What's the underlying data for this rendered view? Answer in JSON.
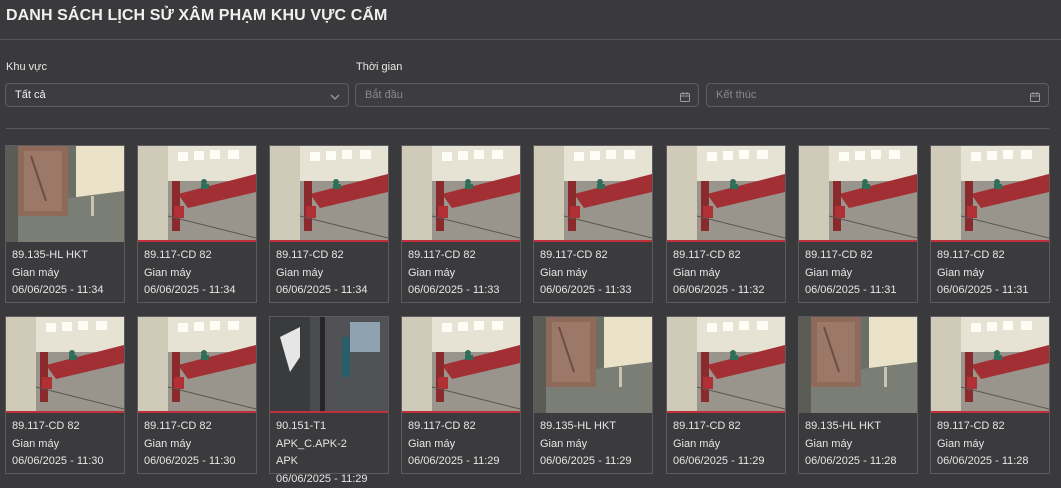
{
  "page": {
    "title": "DANH SÁCH LỊCH SỬ XÂM PHẠM KHU VỰC CẤM"
  },
  "filters": {
    "area_label": "Khu vực",
    "area_value": "Tất cả",
    "time_label": "Thời gian",
    "start_placeholder": "Bắt đầu",
    "end_placeholder": "Kết thúc"
  },
  "icons": {
    "dropdown": "chevron-down-icon",
    "calendar": "calendar-icon"
  },
  "events": [
    {
      "thumb": "pillar",
      "camera": "89.135-HL HKT",
      "area": "Gian máy",
      "time": "06/06/2025 - 11:34"
    },
    {
      "thumb": "hall",
      "camera": "89.117-CD 82",
      "area": "Gian máy",
      "time": "06/06/2025 - 11:34"
    },
    {
      "thumb": "hall",
      "camera": "89.117-CD 82",
      "area": "Gian máy",
      "time": "06/06/2025 - 11:34"
    },
    {
      "thumb": "hall",
      "camera": "89.117-CD 82",
      "area": "Gian máy",
      "time": "06/06/2025 - 11:33"
    },
    {
      "thumb": "hall",
      "camera": "89.117-CD 82",
      "area": "Gian máy",
      "time": "06/06/2025 - 11:33"
    },
    {
      "thumb": "hall",
      "camera": "89.117-CD 82",
      "area": "Gian máy",
      "time": "06/06/2025 - 11:32"
    },
    {
      "thumb": "hall",
      "camera": "89.117-CD 82",
      "area": "Gian máy",
      "time": "06/06/2025 - 11:31"
    },
    {
      "thumb": "hall",
      "camera": "89.117-CD 82",
      "area": "Gian máy",
      "time": "06/06/2025 - 11:31"
    },
    {
      "thumb": "hall",
      "camera": "89.117-CD 82",
      "area": "Gian máy",
      "time": "06/06/2025 - 11:30"
    },
    {
      "thumb": "hall",
      "camera": "89.117-CD 82",
      "area": "Gian máy",
      "time": "06/06/2025 - 11:30"
    },
    {
      "thumb": "door",
      "camera": "90.151-T1",
      "area": "APK_C.APK-2",
      "extra": "APK",
      "time": "06/06/2025 - 11:29"
    },
    {
      "thumb": "hall",
      "camera": "89.117-CD 82",
      "area": "Gian máy",
      "time": "06/06/2025 - 11:29"
    },
    {
      "thumb": "pillar",
      "camera": "89.135-HL HKT",
      "area": "Gian máy",
      "time": "06/06/2025 - 11:29"
    },
    {
      "thumb": "hall",
      "camera": "89.117-CD 82",
      "area": "Gian máy",
      "time": "06/06/2025 - 11:29"
    },
    {
      "thumb": "pillar",
      "camera": "89.135-HL HKT",
      "area": "Gian máy",
      "time": "06/06/2025 - 11:28"
    },
    {
      "thumb": "hall",
      "camera": "89.117-CD 82",
      "area": "Gian máy",
      "time": "06/06/2025 - 11:28"
    }
  ]
}
